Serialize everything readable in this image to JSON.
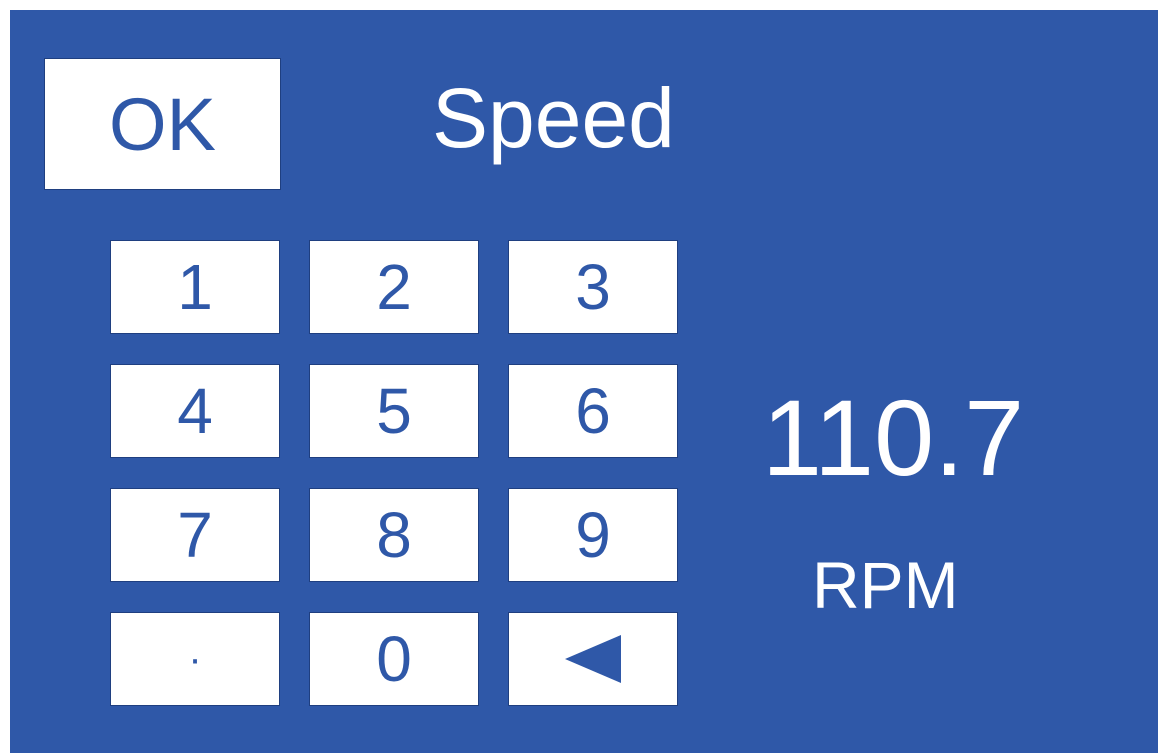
{
  "header": {
    "ok_label": "OK",
    "title": "Speed"
  },
  "keypad": {
    "keys": [
      "1",
      "2",
      "3",
      "4",
      "5",
      "6",
      "7",
      "8",
      "9",
      "·",
      "0"
    ],
    "backspace_icon": "backspace-triangle-icon"
  },
  "display": {
    "value": "110.7",
    "unit": "RPM"
  },
  "colors": {
    "panel_background": "#2f58a8",
    "key_background": "#ffffff",
    "key_text": "#2f58a8",
    "display_text": "#ffffff"
  }
}
